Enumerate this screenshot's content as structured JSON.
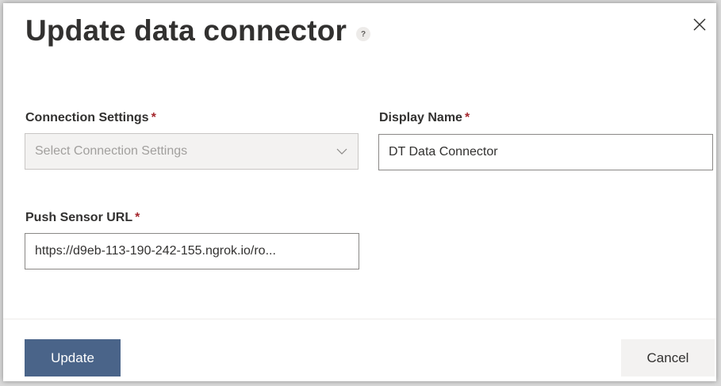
{
  "dialog": {
    "title": "Update data connector",
    "help_icon": "?",
    "close_icon": "close-icon"
  },
  "form": {
    "connection_settings": {
      "label": "Connection Settings",
      "required": "*",
      "placeholder": "Select Connection Settings",
      "icon": "chevron-down-icon"
    },
    "display_name": {
      "label": "Display Name",
      "required": "*",
      "value": "DT Data Connector"
    },
    "push_sensor_url": {
      "label": "Push Sensor URL",
      "required": "*",
      "value": "https://d9eb-113-190-242-155.ngrok.io/ro..."
    }
  },
  "footer": {
    "update_label": "Update",
    "cancel_label": "Cancel"
  },
  "colors": {
    "primary_button": "#4a6489",
    "required_asterisk": "#a4262c"
  }
}
